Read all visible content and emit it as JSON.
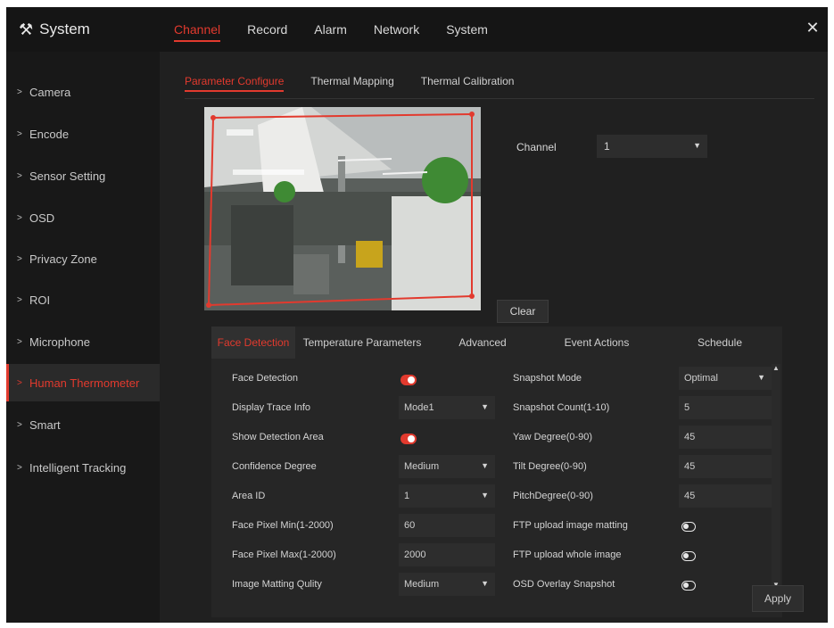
{
  "app": {
    "title": "System",
    "close_icon": "close-icon"
  },
  "topnav": [
    "Channel",
    "Record",
    "Alarm",
    "Network",
    "System"
  ],
  "sidebar": [
    "Camera",
    "Encode",
    "Sensor Setting",
    "OSD",
    "Privacy Zone",
    "ROI",
    "Microphone",
    "Human Thermometer",
    "Smart",
    "Intelligent Tracking"
  ],
  "subtabs": [
    "Parameter Configure",
    "Thermal Mapping",
    "Thermal Calibration"
  ],
  "channel": {
    "label": "Channel",
    "value": "1"
  },
  "clear_label": "Clear",
  "detail_tabs": [
    "Face Detection",
    "Temperature Parameters",
    "Advanced",
    "Event Actions",
    "Schedule"
  ],
  "left_form": {
    "face_detection": {
      "label": "Face Detection",
      "on": true
    },
    "display_trace": {
      "label": "Display Trace Info",
      "value": "Mode1"
    },
    "show_area": {
      "label": "Show Detection Area",
      "on": true
    },
    "confidence": {
      "label": "Confidence Degree",
      "value": "Medium"
    },
    "area_id": {
      "label": "Area ID",
      "value": "1"
    },
    "pixel_min": {
      "label": "Face Pixel Min(1-2000)",
      "value": "60"
    },
    "pixel_max": {
      "label": "Face Pixel Max(1-2000)",
      "value": "2000"
    },
    "matting_quality": {
      "label": "Image Matting Qulity",
      "value": "Medium"
    }
  },
  "right_form": {
    "snapshot_mode": {
      "label": "Snapshot Mode",
      "value": "Optimal"
    },
    "snapshot_count": {
      "label": "Snapshot Count(1-10)",
      "value": "5"
    },
    "yaw": {
      "label": "Yaw Degree(0-90)",
      "value": "45"
    },
    "tilt": {
      "label": "Tilt Degree(0-90)",
      "value": "45"
    },
    "pitch": {
      "label": "PitchDegree(0-90)",
      "value": "45"
    },
    "ftp_matting": {
      "label": "FTP upload image matting",
      "on": false
    },
    "ftp_whole": {
      "label": "FTP upload whole image",
      "on": false
    },
    "osd_overlay": {
      "label": "OSD Overlay Snapshot",
      "on": false
    }
  },
  "apply_label": "Apply",
  "colors": {
    "accent": "#e23a2e",
    "panel": "#262626",
    "background": "#1f1f1f"
  }
}
